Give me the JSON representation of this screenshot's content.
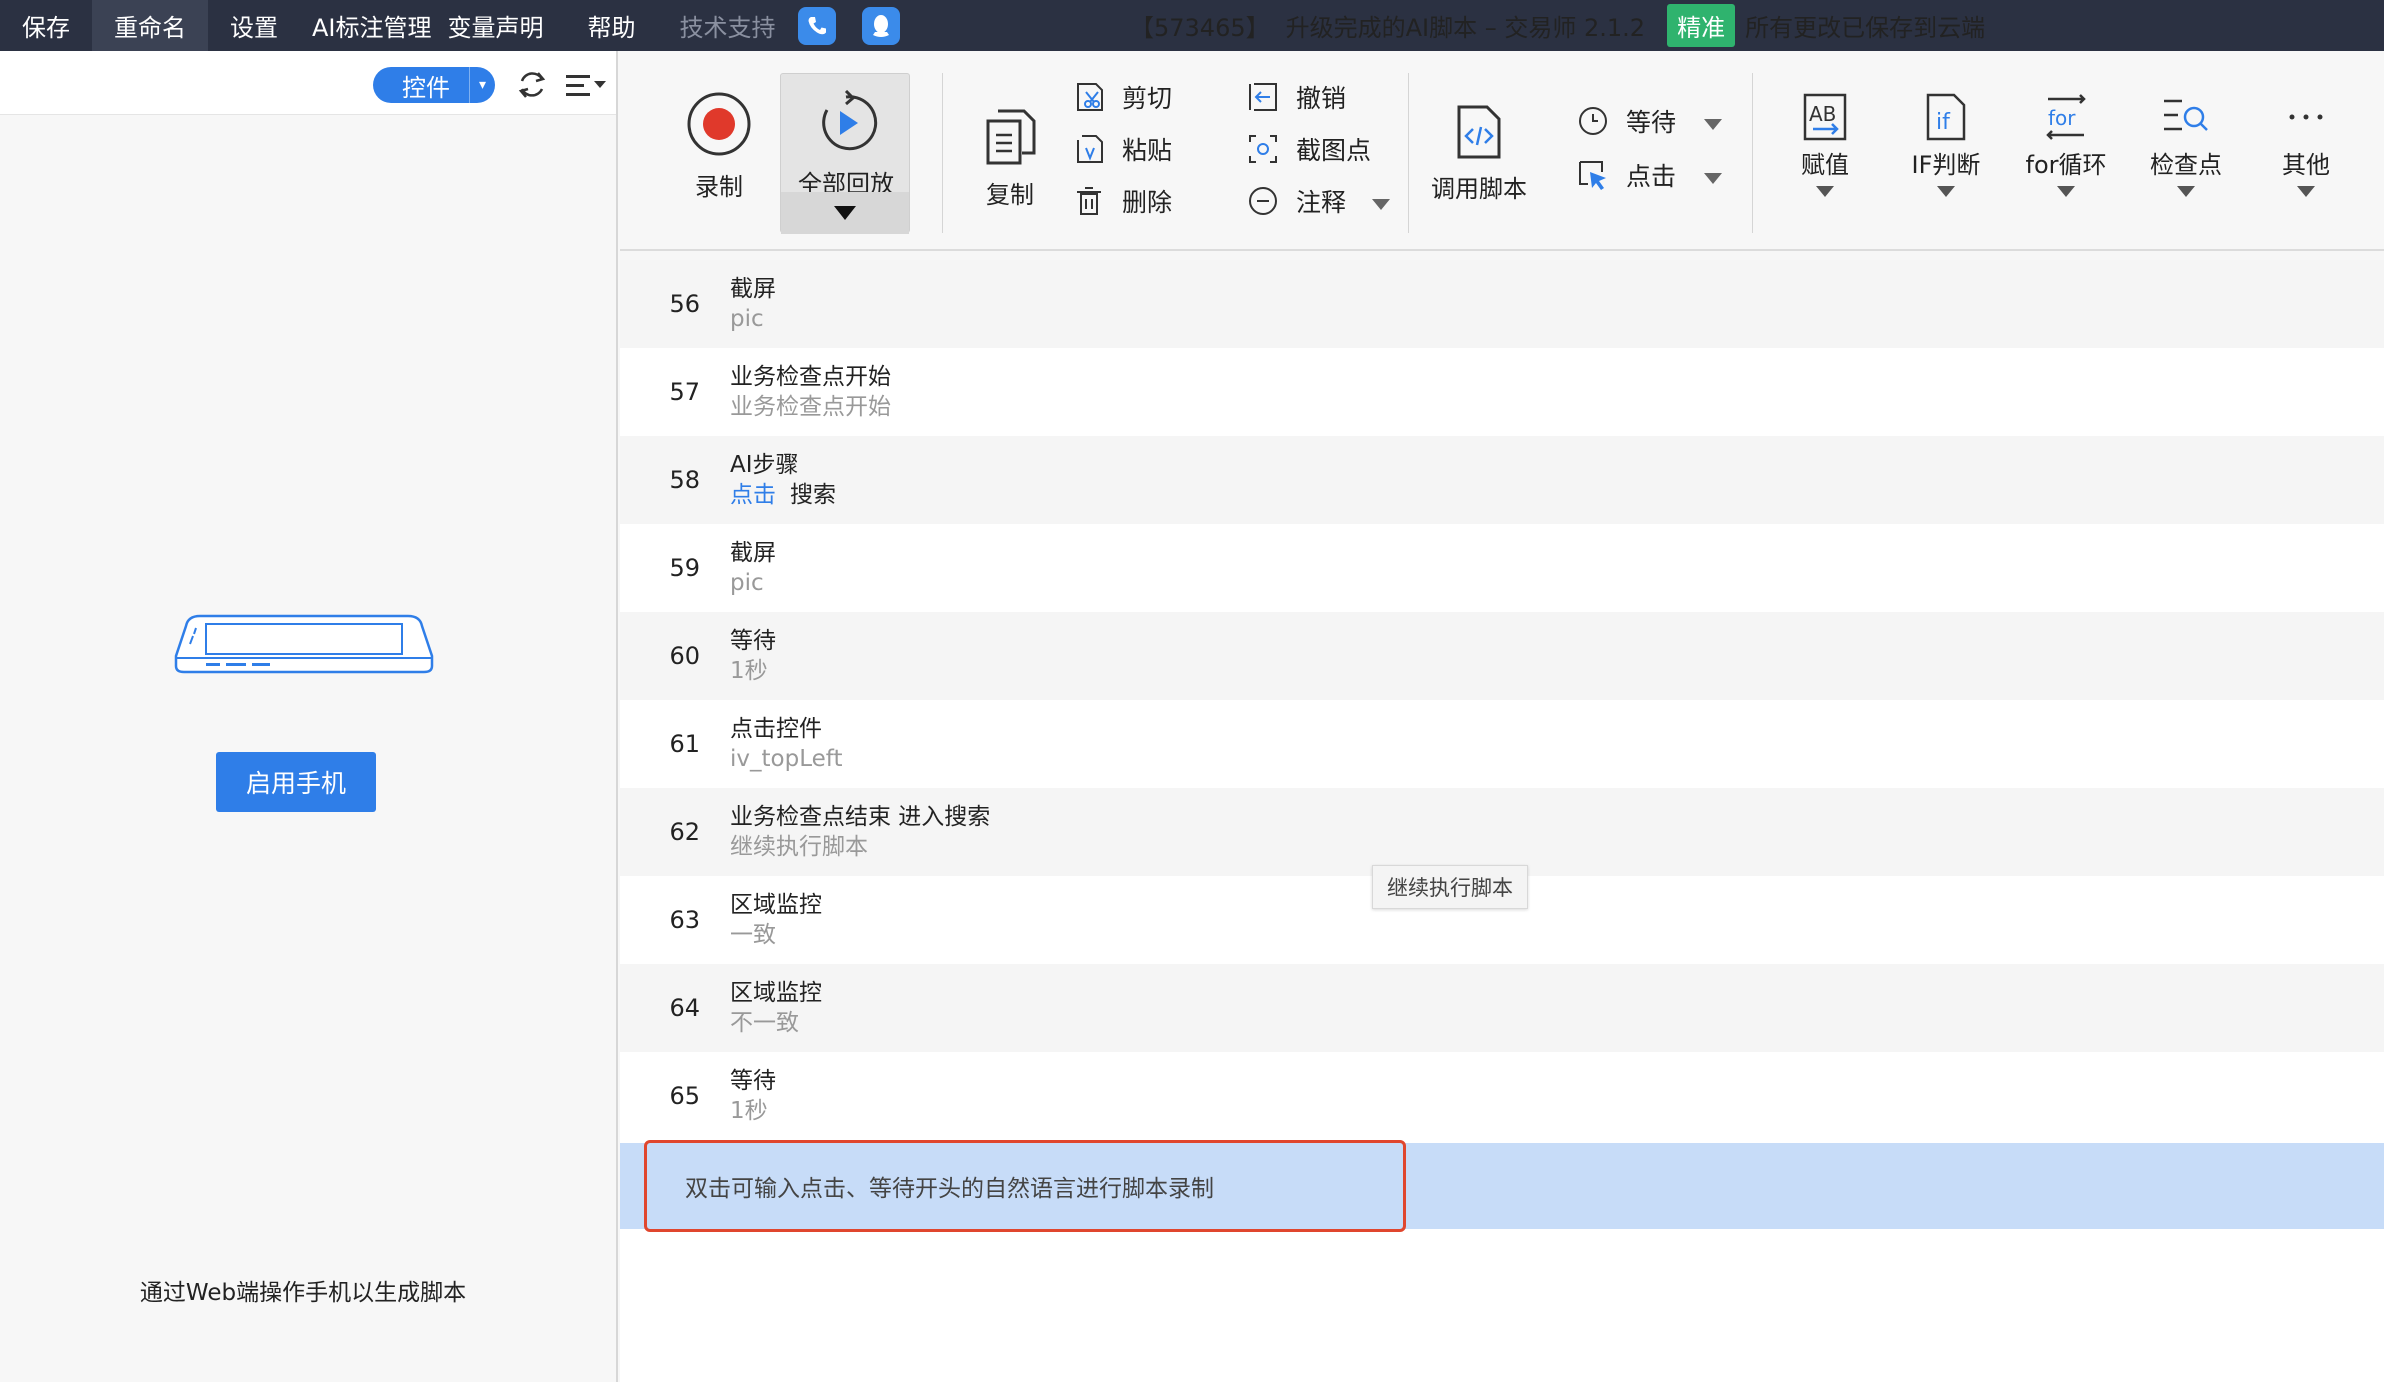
{
  "menu": {
    "items": [
      "保存",
      "重命名",
      "设置",
      "AI标注管理",
      "变量声明",
      "帮助",
      "技术支持"
    ]
  },
  "title": {
    "id": "【573465】",
    "name": "升级完成的AI脚本 – 交易师 2.1.2",
    "badge": "精准",
    "status": "所有更改已保存到云端"
  },
  "left_panel": {
    "control_button": "控件",
    "start_button": "启用手机",
    "tip": "通过Web端操作手机以生成脚本"
  },
  "toolbar": {
    "record": "录制",
    "play_all": "全部回放",
    "copy": "复制",
    "cut": "剪切",
    "paste": "粘贴",
    "delete": "删除",
    "undo": "撤销",
    "screenshot_point": "截图点",
    "comment": "注释",
    "call_script": "调用脚本",
    "wait": "等待",
    "click": "点击",
    "assign": "赋值",
    "if": "IF判断",
    "for": "for循环",
    "checkpoint": "检查点",
    "other": "其他"
  },
  "steps": [
    {
      "num": "56",
      "title": "截屏",
      "sub": "pic"
    },
    {
      "num": "57",
      "title": "业务检查点开始",
      "sub": "业务检查点开始"
    },
    {
      "num": "58",
      "title": "AI步骤",
      "sub_action": "点击",
      "sub_target": "搜索"
    },
    {
      "num": "59",
      "title": "截屏",
      "sub": "pic"
    },
    {
      "num": "60",
      "title": "等待",
      "sub": "1秒"
    },
    {
      "num": "61",
      "title": "点击控件",
      "sub": "iv_topLeft"
    },
    {
      "num": "62",
      "title": "业务检查点结束 进入搜索",
      "sub": "继续执行脚本"
    },
    {
      "num": "63",
      "title": "区域监控",
      "sub": "一致"
    },
    {
      "num": "64",
      "title": "区域监控",
      "sub": "不一致"
    },
    {
      "num": "65",
      "title": "等待",
      "sub": "1秒"
    }
  ],
  "input_placeholder": "双击可输入点击、等待开头的自然语言进行脚本录制",
  "tooltip": "继续执行脚本"
}
